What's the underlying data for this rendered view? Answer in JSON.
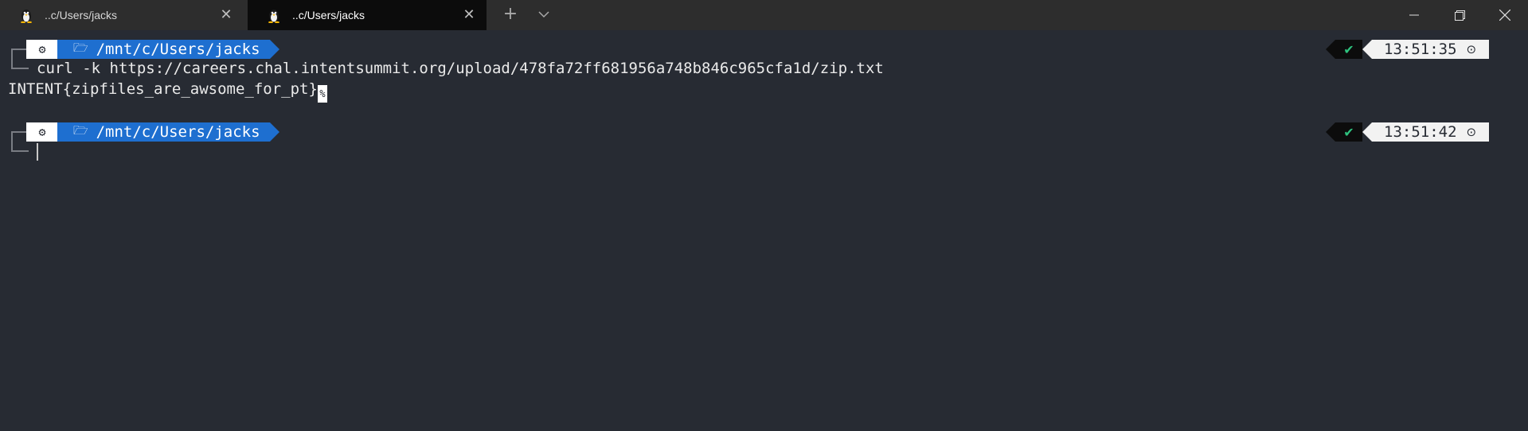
{
  "tabs": [
    {
      "title": "..c/Users/jacks",
      "active": false
    },
    {
      "title": "..c/Users/jacks",
      "active": true
    }
  ],
  "tabbar": {
    "new_tab_symbol": "+",
    "close_symbol": "✕"
  },
  "prompts": [
    {
      "os_icon": "⚙",
      "folder_icon": "🗁",
      "path": "/mnt/c/Users/jacks",
      "status": "✔",
      "time": "13:51:35",
      "clock_icon": "⊙",
      "command": "curl -k https://careers.chal.intentsummit.org/upload/478fa72ff681956a748b846c965cfa1d/zip.txt"
    },
    {
      "os_icon": "⚙",
      "folder_icon": "🗁",
      "path": "/mnt/c/Users/jacks",
      "status": "✔",
      "time": "13:51:42",
      "clock_icon": "⊙",
      "command": ""
    }
  ],
  "output": {
    "text": "INTENT{zipfiles_are_awsome_for_pt}",
    "cursor_glyph": "%"
  },
  "colors": {
    "terminal_bg": "#272b33",
    "path_segment": "#1e6fd0",
    "status_ok": "#2ec27e"
  }
}
